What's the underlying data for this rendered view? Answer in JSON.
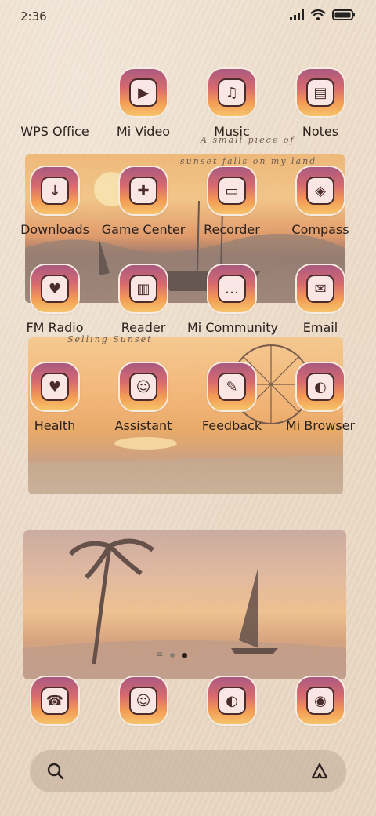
{
  "status": {
    "time": "2:36",
    "icons": [
      "signal-icon",
      "wifi-icon",
      "battery-icon"
    ]
  },
  "handwriting": {
    "line1": "A small piece of",
    "line2": "sunset falls on my land",
    "line3": "Selling Sunset"
  },
  "apps": [
    {
      "label": "WPS Office",
      "icon": "wps-office-icon",
      "glyph": ""
    },
    {
      "label": "Mi Video",
      "icon": "mi-video-icon",
      "glyph": "▶"
    },
    {
      "label": "Music",
      "icon": "music-icon",
      "glyph": "♫"
    },
    {
      "label": "Notes",
      "icon": "notes-icon",
      "glyph": "▤"
    },
    {
      "label": "Downloads",
      "icon": "downloads-icon",
      "glyph": "↓"
    },
    {
      "label": "Game Center",
      "icon": "game-center-icon",
      "glyph": "✚"
    },
    {
      "label": "Recorder",
      "icon": "recorder-icon",
      "glyph": "▭"
    },
    {
      "label": "Compass",
      "icon": "compass-icon",
      "glyph": "◈"
    },
    {
      "label": "FM Radio",
      "icon": "fm-radio-icon",
      "glyph": "♥"
    },
    {
      "label": "Reader",
      "icon": "reader-icon",
      "glyph": "▥"
    },
    {
      "label": "Mi Community",
      "icon": "mi-community-icon",
      "glyph": "…"
    },
    {
      "label": "Email",
      "icon": "email-icon",
      "glyph": "✉"
    },
    {
      "label": "Health",
      "icon": "health-icon",
      "glyph": "♥"
    },
    {
      "label": "Assistant",
      "icon": "assistant-icon",
      "glyph": "☺"
    },
    {
      "label": "Feedback",
      "icon": "feedback-icon",
      "glyph": "✎"
    },
    {
      "label": "Mi Browser",
      "icon": "mi-browser-icon",
      "glyph": "◐"
    }
  ],
  "dock": [
    {
      "icon": "phone-icon",
      "glyph": "☎"
    },
    {
      "icon": "messages-icon",
      "glyph": "☺"
    },
    {
      "icon": "browser-icon",
      "glyph": "◐"
    },
    {
      "icon": "camera-icon",
      "glyph": "◉"
    }
  ],
  "pager": {
    "pages": 3,
    "current": 3
  },
  "search": {
    "left_icon": "search-icon",
    "right_icon": "assistant-triangle-icon"
  }
}
